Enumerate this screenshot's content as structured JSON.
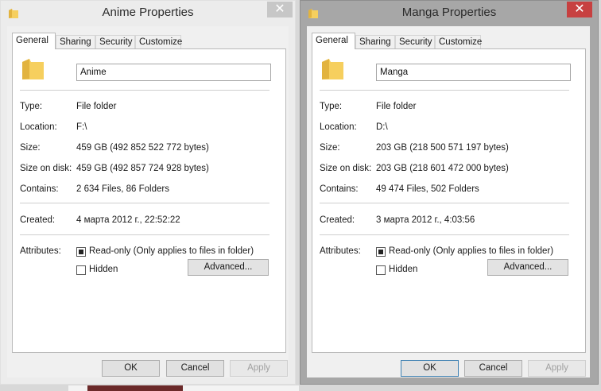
{
  "colors": {
    "folder_yellow": "#f6cf5e",
    "folder_dark": "#e2b33f",
    "inactive_title_bg": "#a7a7a7",
    "active_title_bg": "#ececec"
  },
  "tabs": [
    "General",
    "Sharing",
    "Security",
    "Customize"
  ],
  "labels": {
    "type": "Type:",
    "location": "Location:",
    "size": "Size:",
    "size_on_disk": "Size on disk:",
    "contains": "Contains:",
    "created": "Created:",
    "attributes": "Attributes:"
  },
  "attributes": {
    "readonly_label": "Read-only (Only applies to files in folder)",
    "hidden_label": "Hidden"
  },
  "buttons": {
    "advanced": "Advanced...",
    "ok": "OK",
    "cancel": "Cancel",
    "apply": "Apply",
    "close": "✕"
  },
  "dialogs": [
    {
      "title": "Anime Properties",
      "name": "Anime",
      "type": "File folder",
      "location": "F:\\",
      "size": "459 GB (492 852 522 772 bytes)",
      "size_on_disk": "459 GB (492 857 724 928 bytes)",
      "contains": "2 634 Files, 86 Folders",
      "created": "4 марта 2012 г., 22:52:22",
      "readonly_checked": true,
      "hidden_checked": false
    },
    {
      "title": "Manga Properties",
      "name": "Manga",
      "type": "File folder",
      "location": "D:\\",
      "size": "203 GB (218 500 571 197 bytes)",
      "size_on_disk": "203 GB (218 601 472 000 bytes)",
      "contains": "49 474 Files, 502 Folders",
      "created": "3 марта 2012 г., 4:03:56",
      "readonly_checked": true,
      "hidden_checked": false
    }
  ]
}
